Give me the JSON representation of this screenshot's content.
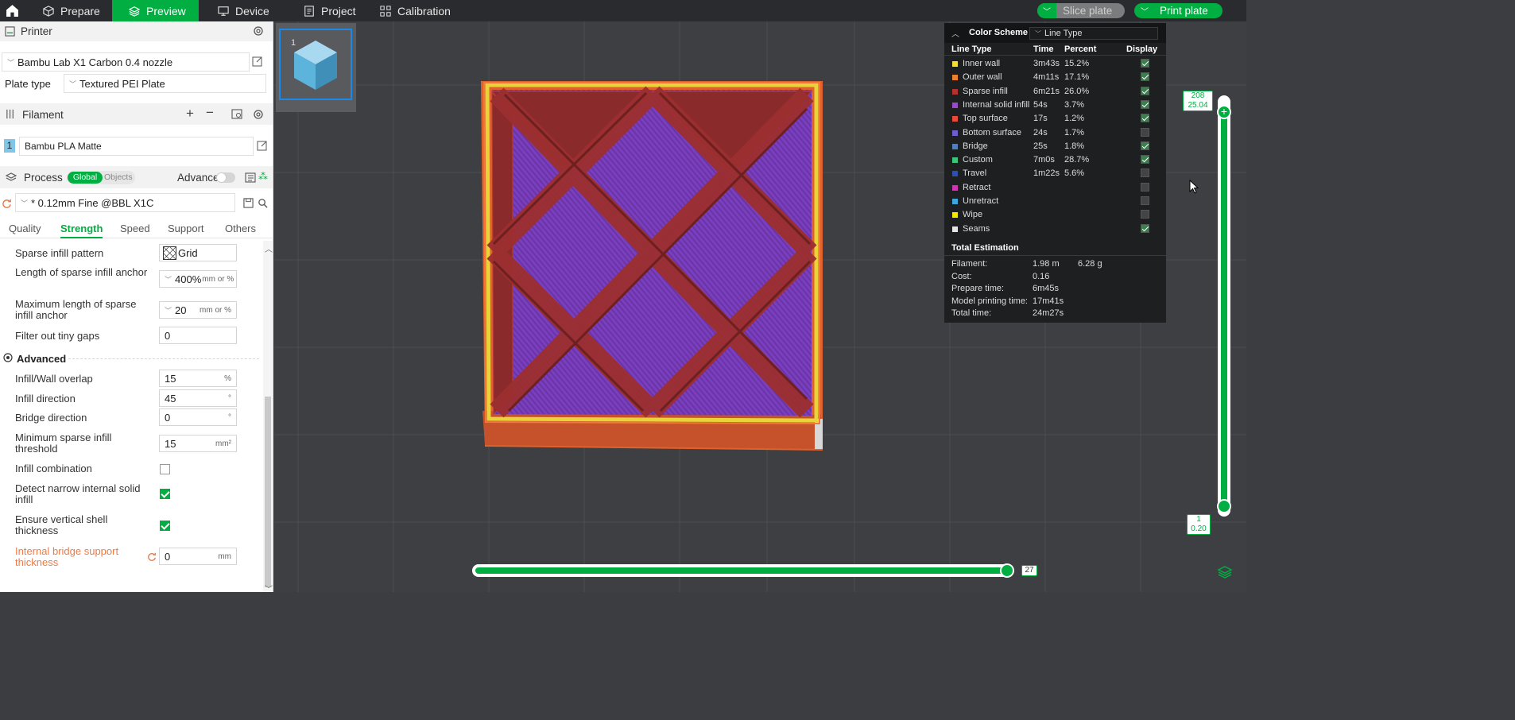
{
  "topbar": {
    "tabs": [
      {
        "label": "Prepare"
      },
      {
        "label": "Preview"
      },
      {
        "label": "Device"
      },
      {
        "label": "Project"
      },
      {
        "label": "Calibration"
      }
    ],
    "slice_plate": "Slice plate",
    "print_plate": "Print plate"
  },
  "printer": {
    "section_title": "Printer",
    "name": "Bambu Lab X1 Carbon 0.4 nozzle",
    "plate_label": "Plate type",
    "plate_value": "Textured PEI Plate"
  },
  "filament": {
    "section_title": "Filament",
    "slot": "1",
    "name": "Bambu PLA Matte"
  },
  "process": {
    "section_title": "Process",
    "toggle_global": "Global",
    "toggle_objects": "Objects",
    "advance_label": "Advance",
    "preset": "* 0.12mm Fine @BBL X1C",
    "tabs": [
      "Quality",
      "Strength",
      "Speed",
      "Support",
      "Others"
    ]
  },
  "settings": {
    "sparse_pattern_label": "Sparse infill pattern",
    "sparse_pattern_value": "Grid",
    "anchor_len_label": "Length of sparse infill anchor",
    "anchor_len_value": "400%",
    "anchor_len_unit": "mm or %",
    "anchor_max_label": "Maximum length of sparse infill anchor",
    "anchor_max_value": "20",
    "anchor_max_unit": "mm or %",
    "tiny_gaps_label": "Filter out tiny gaps",
    "tiny_gaps_value": "0",
    "advanced_title": "Advanced",
    "overlap_label": "Infill/Wall overlap",
    "overlap_value": "15",
    "overlap_unit": "%",
    "infill_dir_label": "Infill direction",
    "infill_dir_value": "45",
    "infill_dir_unit": "°",
    "bridge_dir_label": "Bridge direction",
    "bridge_dir_value": "0",
    "bridge_dir_unit": "°",
    "min_sparse_label": "Minimum sparse infill threshold",
    "min_sparse_value": "15",
    "min_sparse_unit": "mm²",
    "combination_label": "Infill combination",
    "narrow_label": "Detect narrow internal solid infill",
    "vertical_label": "Ensure vertical shell thickness",
    "bridge_support_label": "Internal bridge support thickness",
    "bridge_support_value": "0",
    "bridge_support_unit": "mm"
  },
  "plate_thumb": {
    "number": "1"
  },
  "legend": {
    "title": "Color Scheme",
    "scheme": "Line Type",
    "headers": [
      "Line Type",
      "Time",
      "Percent",
      "Display"
    ],
    "rows": [
      {
        "name": "Inner wall",
        "time": "3m43s",
        "percent": "15.2%",
        "color": "#f5e02e",
        "display": true
      },
      {
        "name": "Outer wall",
        "time": "4m11s",
        "percent": "17.1%",
        "color": "#ee7f2c",
        "display": true
      },
      {
        "name": "Sparse infill",
        "time": "6m21s",
        "percent": "26.0%",
        "color": "#b3312e",
        "display": true
      },
      {
        "name": "Internal solid infill",
        "time": "54s",
        "percent": "3.7%",
        "color": "#9b49c9",
        "display": true
      },
      {
        "name": "Top surface",
        "time": "17s",
        "percent": "1.2%",
        "color": "#e84a3a",
        "display": true
      },
      {
        "name": "Bottom surface",
        "time": "24s",
        "percent": "1.7%",
        "color": "#6f5ec9",
        "display": false
      },
      {
        "name": "Bridge",
        "time": "25s",
        "percent": "1.8%",
        "color": "#4f7fc0",
        "display": true
      },
      {
        "name": "Custom",
        "time": "7m0s",
        "percent": "28.7%",
        "color": "#3ec47a",
        "display": true
      },
      {
        "name": "Travel",
        "time": "1m22s",
        "percent": "5.6%",
        "color": "#2f4fb0",
        "display": false
      },
      {
        "name": "Retract",
        "time": "",
        "percent": "",
        "color": "#d62fb8",
        "display": false
      },
      {
        "name": "Unretract",
        "time": "",
        "percent": "",
        "color": "#3fa6dc",
        "display": false
      },
      {
        "name": "Wipe",
        "time": "",
        "percent": "",
        "color": "#f2e800",
        "display": false
      },
      {
        "name": "Seams",
        "time": "",
        "percent": "",
        "color": "#e6e6e6",
        "display": true
      }
    ],
    "total_title": "Total Estimation",
    "totals": [
      {
        "label": "Filament:",
        "value": "1.98 m",
        "extra": "6.28 g"
      },
      {
        "label": "Cost:",
        "value": "0.16",
        "extra": ""
      },
      {
        "label": "Prepare time:",
        "value": "6m45s",
        "extra": ""
      },
      {
        "label": "Model printing time:",
        "value": "17m41s",
        "extra": ""
      },
      {
        "label": "Total time:",
        "value": "24m27s",
        "extra": ""
      }
    ]
  },
  "layer_slider": {
    "top_layer": "208",
    "top_height": "25.04",
    "bottom_layer": "1",
    "bottom_height": "0.20"
  },
  "move_slider": {
    "value": "27"
  },
  "colors": {
    "accent": "#00ae42",
    "orange": "#e0612c",
    "infill": "#8b2a2a",
    "solid": "#7a3fbf"
  }
}
